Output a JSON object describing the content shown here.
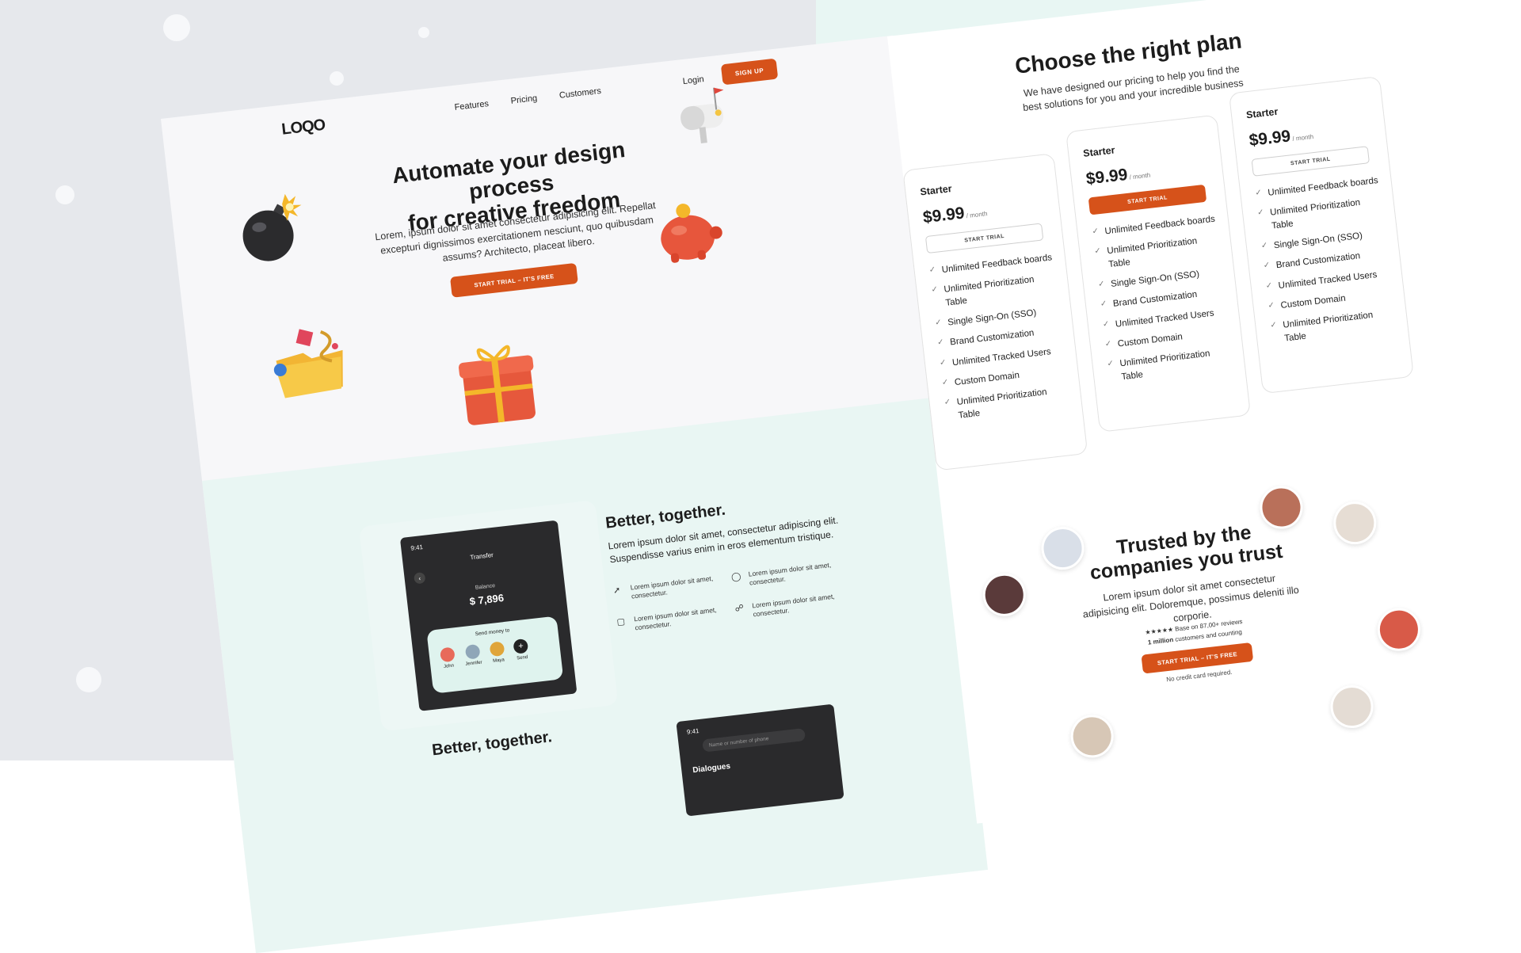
{
  "left_page": {
    "logo": "LOQO",
    "nav": [
      "Features",
      "Pricing",
      "Customers"
    ],
    "login": "Login",
    "signup": "SIGN UP",
    "hero": {
      "title_line1": "Automate your design process",
      "title_line2": "for creative freedom",
      "subtitle": "Lorem, ipsum dolor sit amet consectetur adipisicing elit. Repellat excepturi dignissimos exercitationem nesciunt, quo quibusdam assums? Architecto, placeat libero.",
      "cta": "START TRIAL – IT'S FREE"
    },
    "phone": {
      "time": "9:41",
      "title": "Transfer",
      "balance_label": "Balance",
      "balance": "$ 7,896",
      "send_label": "Send money to",
      "contacts": [
        "John",
        "Jennifer",
        "Maya",
        "Send"
      ]
    },
    "better": {
      "title": "Better, together.",
      "subtitle": "Lorem ipsum dolor sit amet, consectetur adipiscing elit. Suspendisse varius enim in eros elementum tristique.",
      "features": [
        "Lorem ipsum dolor sit amet, consectetur.",
        "Lorem ipsum dolor sit amet, consectetur.",
        "Lorem ipsum dolor sit amet, consectetur.",
        "Lorem ipsum dolor sit amet, consectetur."
      ]
    },
    "better2": {
      "title": "Better, together."
    },
    "phone2": {
      "time": "9:41",
      "search_placeholder": "Name or number of phone",
      "heading": "Dialogues"
    }
  },
  "right_page": {
    "title": "Choose the right plan",
    "subtitle": "We have designed our pricing to help you find the best solutions for you and your incredible business",
    "plans": [
      {
        "name": "Starter",
        "price": "$9.99",
        "period": "/ month",
        "button": "START TRIAL",
        "featured": false,
        "features": [
          "Unlimited Feedback boards",
          "Unlimited Prioritization Table",
          "Single Sign-On (SSO)",
          "Brand Customization",
          "Unlimited Tracked Users",
          "Custom Domain",
          "Unlimited Prioritization Table"
        ]
      },
      {
        "name": "Starter",
        "price": "$9.99",
        "period": "/ month",
        "button": "START TRIAL",
        "featured": true,
        "features": [
          "Unlimited Feedback boards",
          "Unlimited Prioritization Table",
          "Single Sign-On (SSO)",
          "Brand Customization",
          "Unlimited Tracked Users",
          "Custom Domain",
          "Unlimited Prioritization Table"
        ]
      },
      {
        "name": "Starter",
        "price": "$9.99",
        "period": "/ month",
        "button": "START TRIAL",
        "featured": false,
        "features": [
          "Unlimited Feedback boards",
          "Unlimited Prioritization Table",
          "Single Sign-On (SSO)",
          "Brand Customization",
          "Unlimited Tracked Users",
          "Custom Domain",
          "Unlimited Prioritization Table"
        ]
      }
    ],
    "trusted": {
      "title_line1": "Trusted by the",
      "title_line2": "companies you trust",
      "subtitle": "Lorem ipsum dolor sit amet consectetur adipisicing elit. Doloremque, possimus deleniti illo corporie.",
      "rating": "★★★★★ Base on 87,00+ reviews",
      "count_strong": "1 million",
      "count_rest": "customers and counting",
      "cta": "START TRIAL – IT'S FREE",
      "note": "No credit card required."
    }
  },
  "colors": {
    "accent": "#d6521a",
    "background": "#e6e8ec",
    "mint": "#e9f6f3"
  }
}
